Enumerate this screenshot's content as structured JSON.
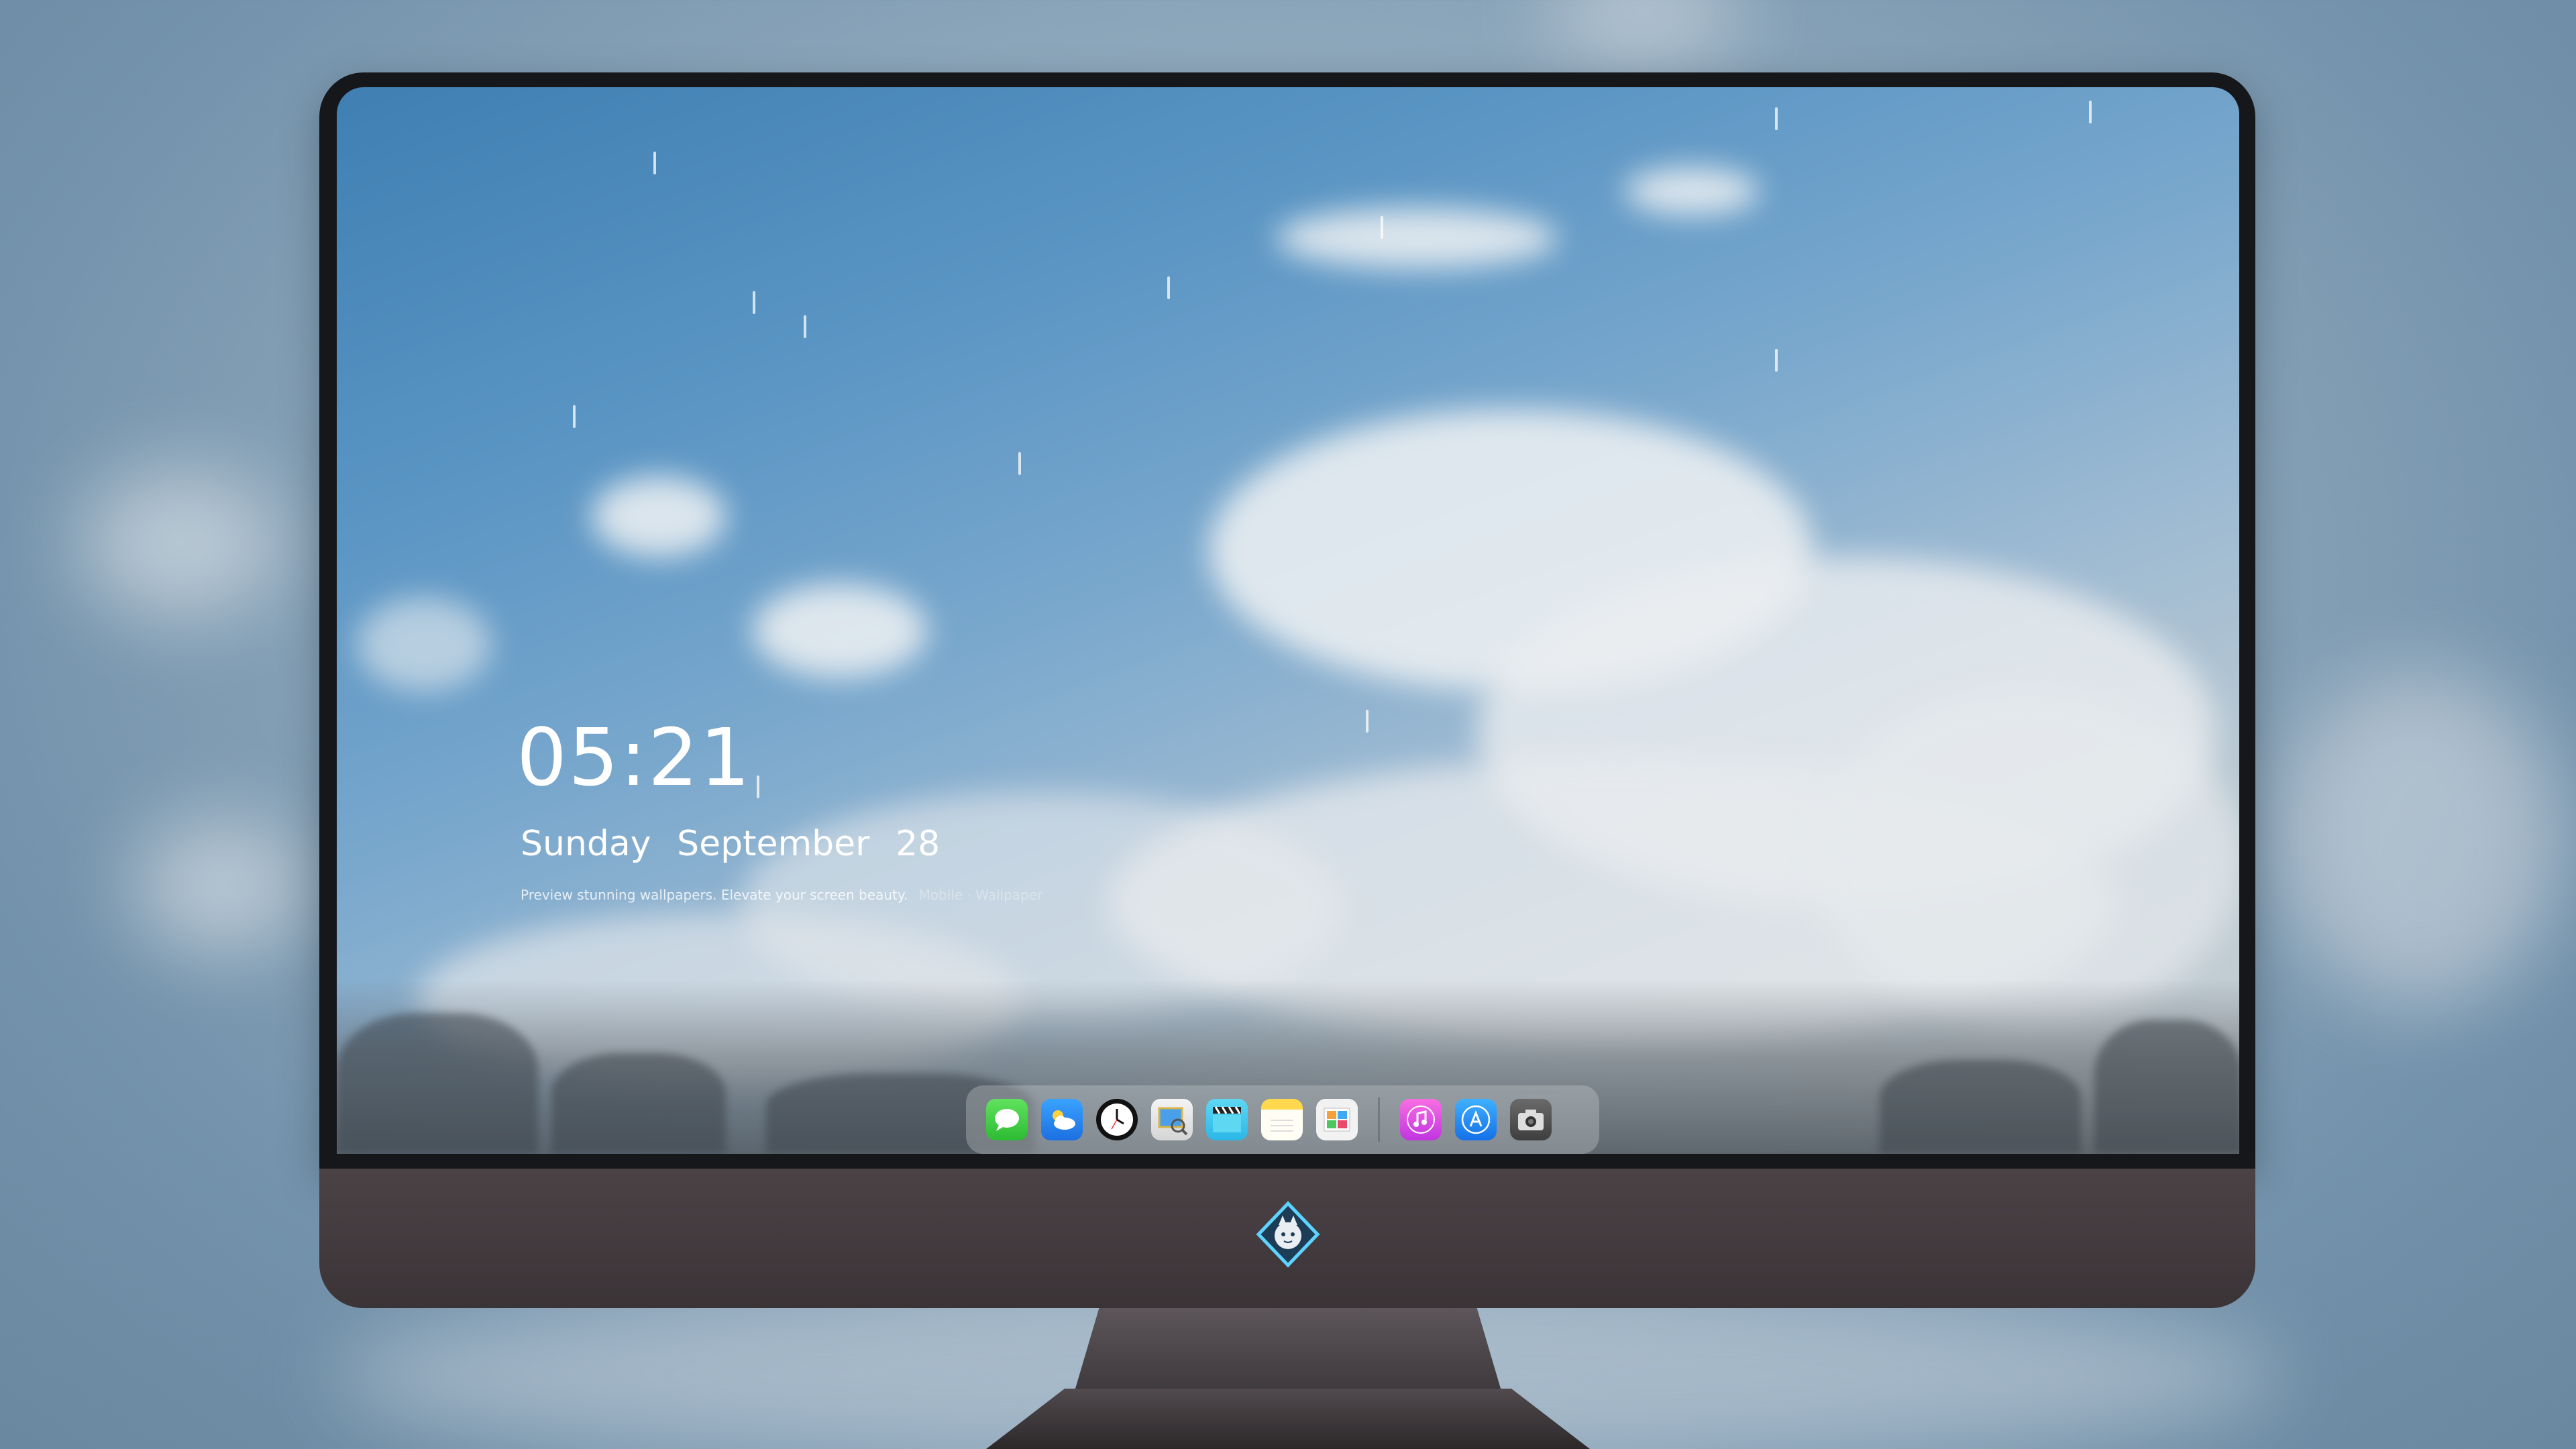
{
  "lockscreen": {
    "time": "05:21",
    "day": "Sunday",
    "month": "September",
    "date": "28",
    "tagline": "Preview stunning wallpapers. Elevate your screen beauty.",
    "tagline_faint": "Mobile · Wallpaper"
  },
  "dock": {
    "apps": [
      {
        "name": "Messages",
        "icon": "messages-icon"
      },
      {
        "name": "Weather",
        "icon": "weather-icon"
      },
      {
        "name": "Clock",
        "icon": "clock-icon"
      },
      {
        "name": "Preview",
        "icon": "preview-icon"
      },
      {
        "name": "Final Cut",
        "icon": "clapperboard-icon"
      },
      {
        "name": "Notes",
        "icon": "notes-icon"
      },
      {
        "name": "Photo Editor",
        "icon": "photos-icon"
      },
      {
        "name": "Music",
        "icon": "music-note-icon"
      },
      {
        "name": "App Store",
        "icon": "app-store-icon"
      },
      {
        "name": "Camera",
        "icon": "camera-icon"
      }
    ]
  },
  "colors": {
    "chin": "#3f373b",
    "dock_bg": "rgba(200,205,210,0.35)",
    "sky": "#5a95c4"
  }
}
